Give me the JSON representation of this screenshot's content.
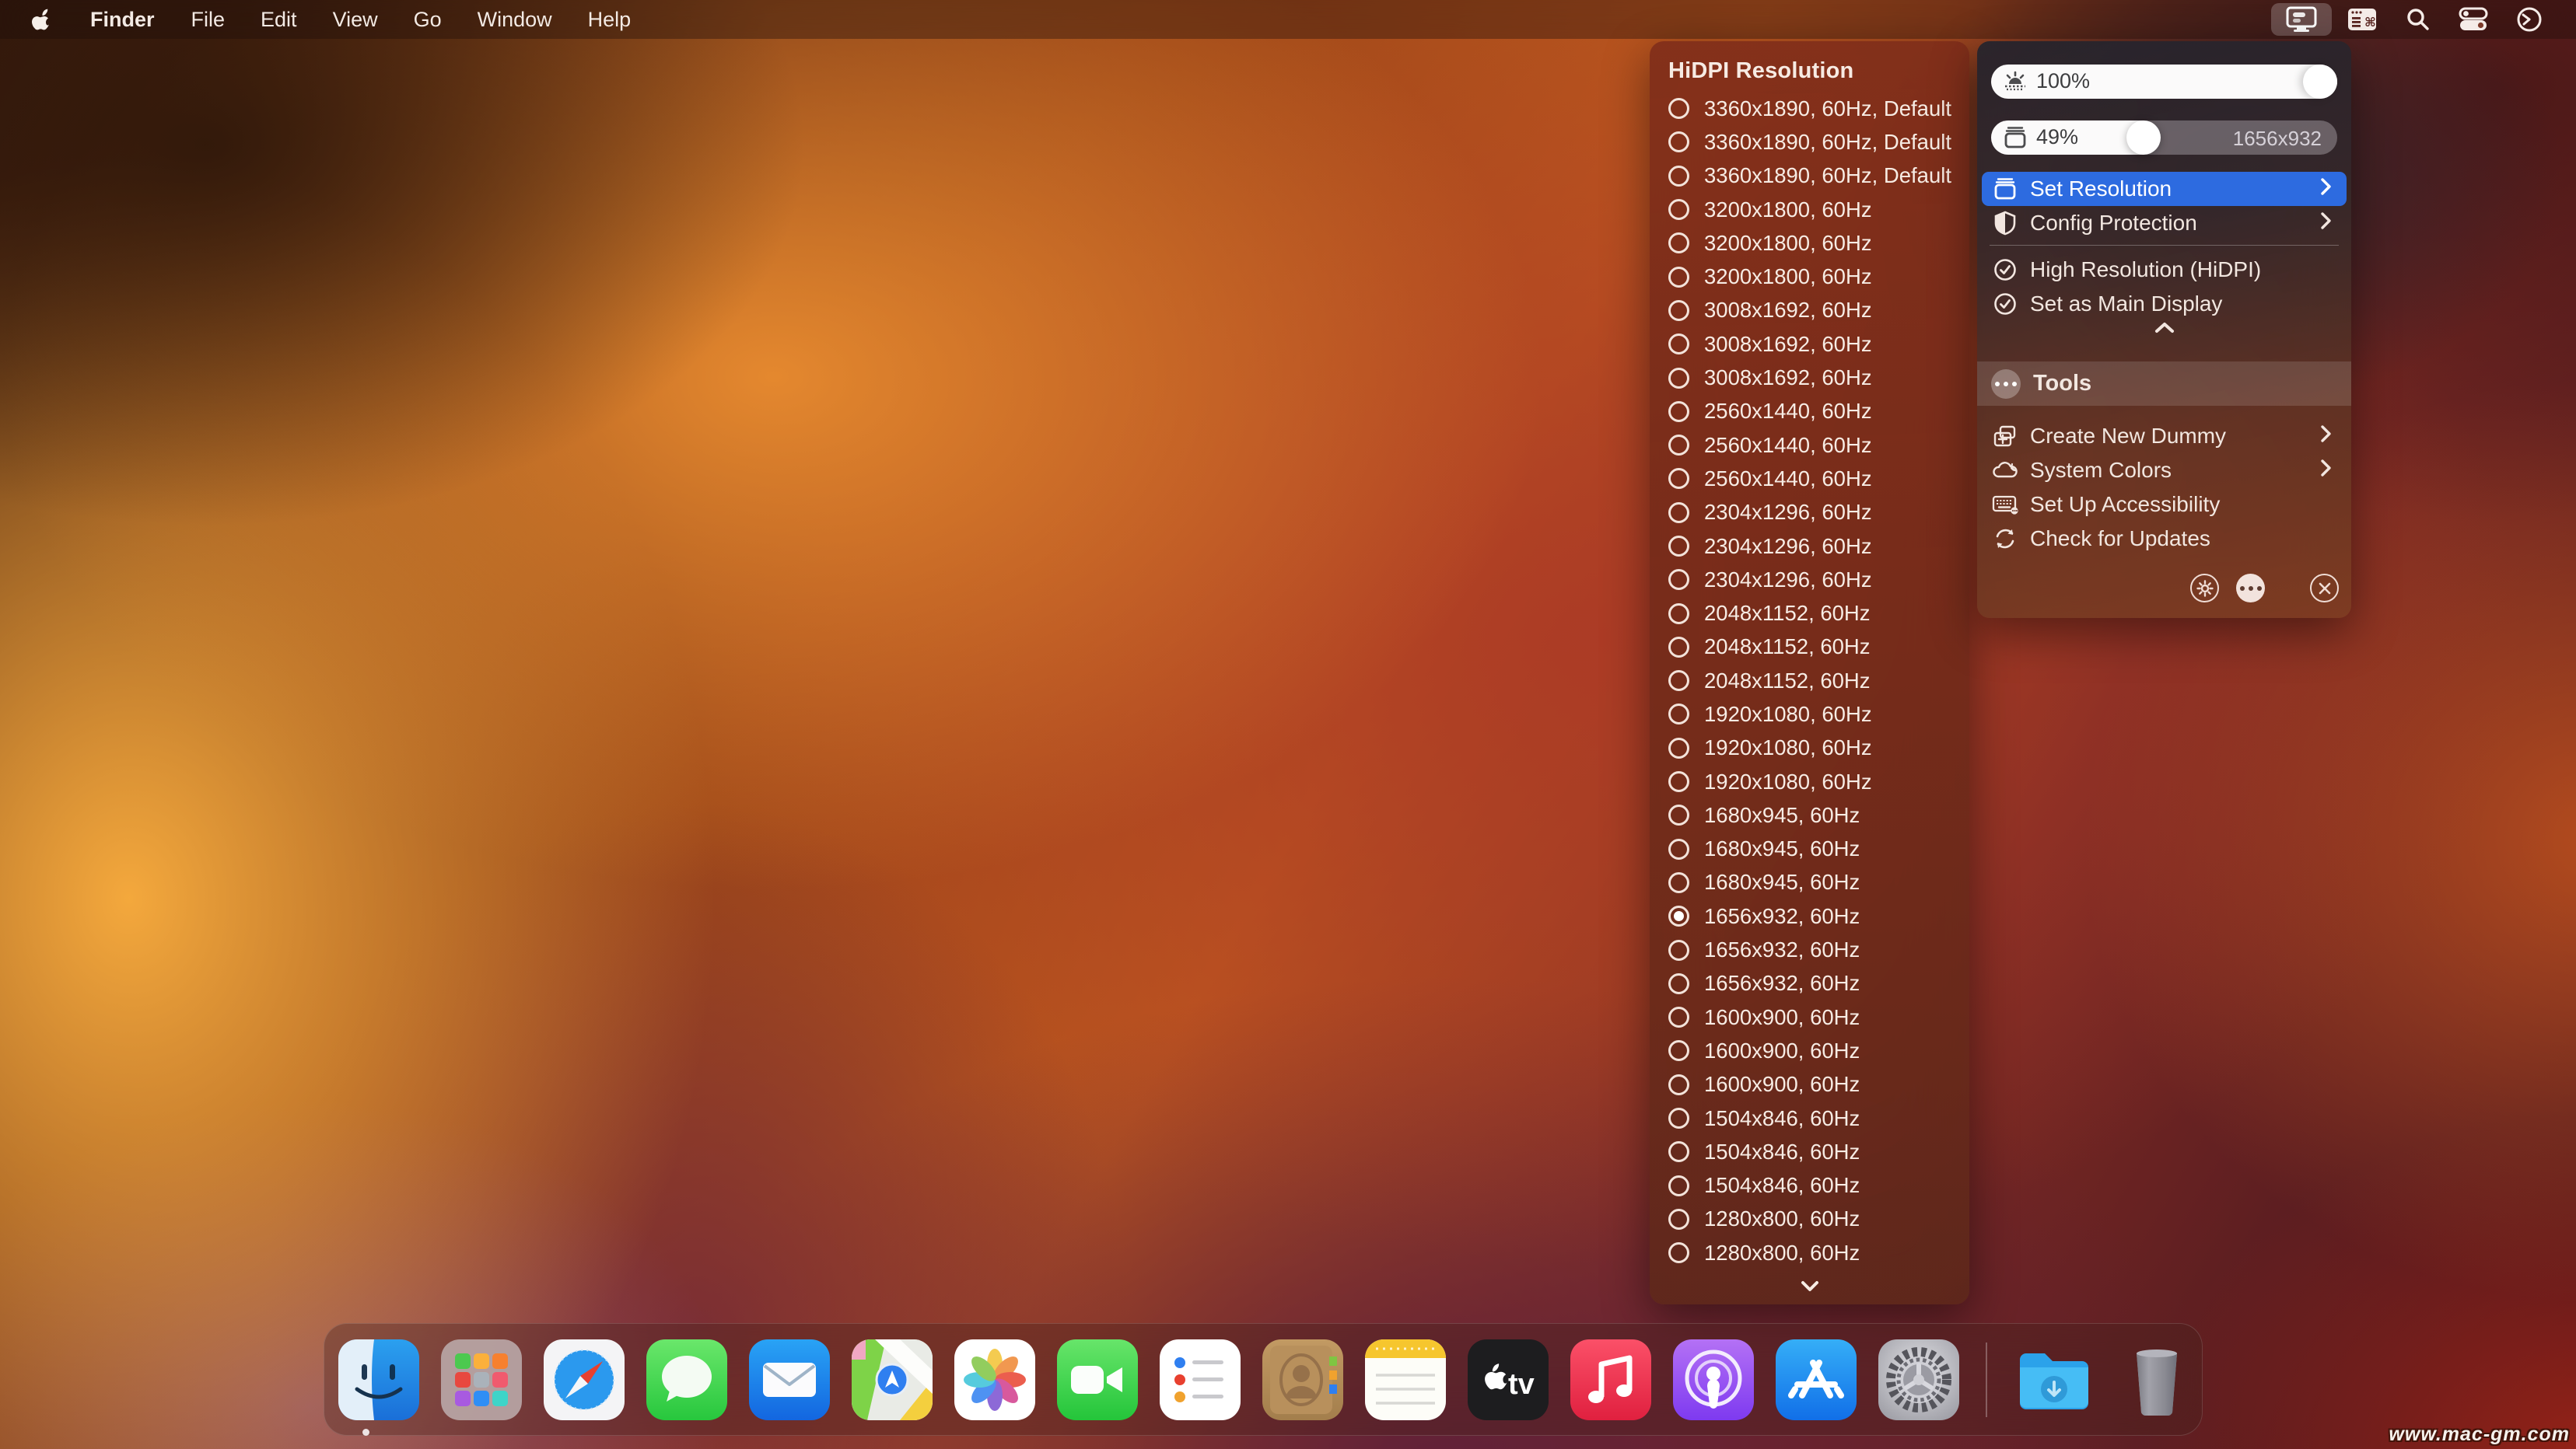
{
  "menu_bar": {
    "app_name": "Finder",
    "menus": [
      "File",
      "Edit",
      "View",
      "Go",
      "Window",
      "Help"
    ],
    "status_icons": [
      "display-icon",
      "window-command-icon",
      "spotlight-search-icon",
      "control-center-icon",
      "clock-icon"
    ]
  },
  "resolution_panel": {
    "title": "HiDPI Resolution",
    "items": [
      {
        "label": "3360x1890, 60Hz, Default",
        "selected": false
      },
      {
        "label": "3360x1890, 60Hz, Default",
        "selected": false
      },
      {
        "label": "3360x1890, 60Hz, Default",
        "selected": false
      },
      {
        "label": "3200x1800, 60Hz",
        "selected": false
      },
      {
        "label": "3200x1800, 60Hz",
        "selected": false
      },
      {
        "label": "3200x1800, 60Hz",
        "selected": false
      },
      {
        "label": "3008x1692, 60Hz",
        "selected": false
      },
      {
        "label": "3008x1692, 60Hz",
        "selected": false
      },
      {
        "label": "3008x1692, 60Hz",
        "selected": false
      },
      {
        "label": "2560x1440, 60Hz",
        "selected": false
      },
      {
        "label": "2560x1440, 60Hz",
        "selected": false
      },
      {
        "label": "2560x1440, 60Hz",
        "selected": false
      },
      {
        "label": "2304x1296, 60Hz",
        "selected": false
      },
      {
        "label": "2304x1296, 60Hz",
        "selected": false
      },
      {
        "label": "2304x1296, 60Hz",
        "selected": false
      },
      {
        "label": "2048x1152, 60Hz",
        "selected": false
      },
      {
        "label": "2048x1152, 60Hz",
        "selected": false
      },
      {
        "label": "2048x1152, 60Hz",
        "selected": false
      },
      {
        "label": "1920x1080, 60Hz",
        "selected": false
      },
      {
        "label": "1920x1080, 60Hz",
        "selected": false
      },
      {
        "label": "1920x1080, 60Hz",
        "selected": false
      },
      {
        "label": "1680x945, 60Hz",
        "selected": false
      },
      {
        "label": "1680x945, 60Hz",
        "selected": false
      },
      {
        "label": "1680x945, 60Hz",
        "selected": false
      },
      {
        "label": "1656x932, 60Hz",
        "selected": true
      },
      {
        "label": "1656x932, 60Hz",
        "selected": false
      },
      {
        "label": "1656x932, 60Hz",
        "selected": false
      },
      {
        "label": "1600x900, 60Hz",
        "selected": false
      },
      {
        "label": "1600x900, 60Hz",
        "selected": false
      },
      {
        "label": "1600x900, 60Hz",
        "selected": false
      },
      {
        "label": "1504x846, 60Hz",
        "selected": false
      },
      {
        "label": "1504x846, 60Hz",
        "selected": false
      },
      {
        "label": "1504x846, 60Hz",
        "selected": false
      },
      {
        "label": "1280x800, 60Hz",
        "selected": false
      },
      {
        "label": "1280x800, 60Hz",
        "selected": false
      }
    ]
  },
  "display_panel": {
    "brightness_slider": {
      "value_label": "100%",
      "percent": 100
    },
    "resolution_slider": {
      "value_label": "49%",
      "percent": 49,
      "right_label": "1656x932"
    },
    "set_resolution": {
      "label": "Set Resolution"
    },
    "config_protection": {
      "label": "Config Protection"
    },
    "high_resolution": {
      "label": "High Resolution (HiDPI)"
    },
    "main_display": {
      "label": "Set as Main Display"
    },
    "tools_header": {
      "label": "Tools"
    },
    "create_dummy": {
      "label": "Create New Dummy"
    },
    "system_colors": {
      "label": "System Colors"
    },
    "accessibility": {
      "label": "Set Up Accessibility"
    },
    "check_updates": {
      "label": "Check for Updates"
    },
    "footer_buttons": [
      "settings-gear-icon",
      "more-ellipsis-icon",
      "close-icon"
    ]
  },
  "dock": {
    "apps": [
      "finder",
      "launchpad",
      "safari",
      "messages",
      "mail",
      "maps",
      "photos",
      "facetime",
      "reminders",
      "contacts",
      "notes",
      "tv",
      "music",
      "podcasts",
      "app-store",
      "system-settings"
    ],
    "right_items": [
      "downloads-folder",
      "trash"
    ],
    "active_app": "finder"
  },
  "watermark": "www.mac-gm.com",
  "colors": {
    "accent_blue": "#2d6be0",
    "panel_red": "#6e2a1a",
    "selection_white": "#ffffff"
  }
}
